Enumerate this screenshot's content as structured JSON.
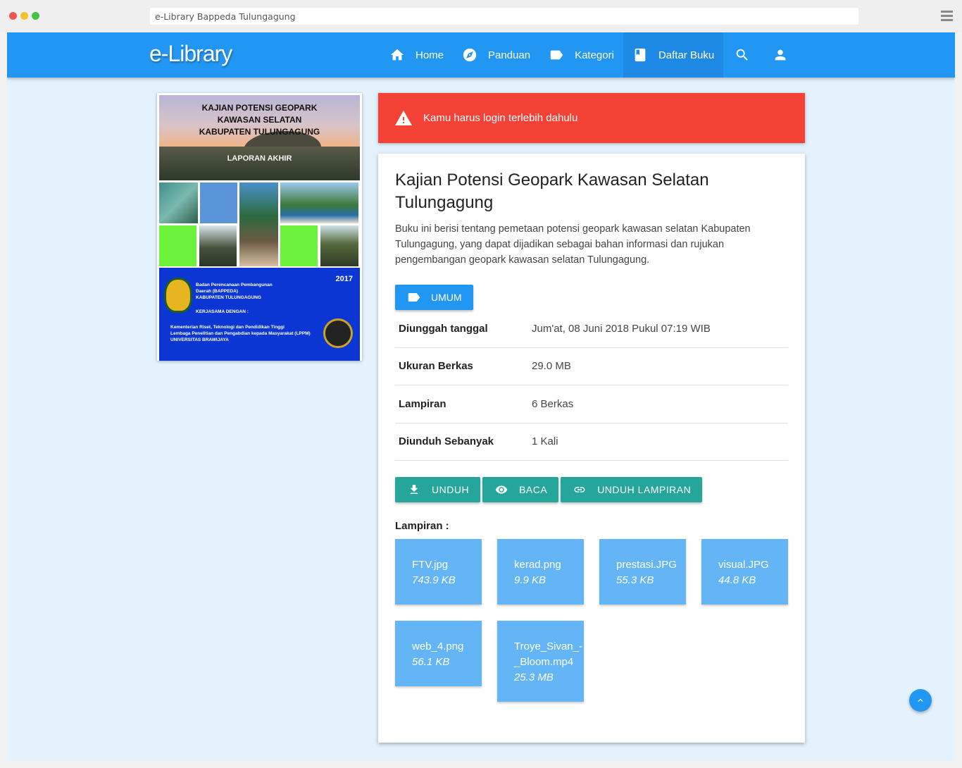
{
  "browser": {
    "url": "e-Library Bappeda Tulungagung"
  },
  "navbar": {
    "brand": "e-Library",
    "items": [
      {
        "label": "Home",
        "icon": "home-icon"
      },
      {
        "label": "Panduan",
        "icon": "compass-icon"
      },
      {
        "label": "Kategori",
        "icon": "label-icon"
      },
      {
        "label": "Daftar Buku",
        "icon": "book-icon",
        "active": true
      }
    ],
    "search_icon": "search-icon",
    "user_icon": "user-icon"
  },
  "cover": {
    "title_lines": [
      "KAJIAN POTENSI GEOPARK",
      "KAWASAN SELATAN",
      "KABUPATEN TULUNGAGUNG"
    ],
    "subtitle": "LAPORAN AKHIR",
    "year": "2017",
    "agency_lines": [
      "Badan Perencanaan Pembangunan",
      "Daerah (BAPPEDA)",
      "KABUPATEN TULUNGAGUNG"
    ],
    "cooperation": "KERJASAMA DENGAN :",
    "partner_lines": [
      "Kementerian Riset, Teknologi dan Pendidikan Tinggi",
      "Lembaga Penelitian dan Pengabdian kepada Masyarakat (LPPM)",
      "UNIVERSITAS BRAWIJAYA"
    ]
  },
  "alert": {
    "message": "Kamu harus login terlebih dahulu",
    "icon": "warning-icon"
  },
  "book": {
    "title": "Kajian Potensi Geopark Kawasan Selatan Tulungagung",
    "description": "Buku ini berisi tentang pemetaan potensi geopark kawasan selatan Kabupaten Tulungagung, yang dapat dijadikan sebagai bahan informasi dan rujukan pengembangan geopark kawasan selatan Tulungagung.",
    "category": "UMUM",
    "info": [
      {
        "label": "Diunggah tanggal",
        "value": "Jum'at, 08 Juni 2018 Pukul 07:19 WIB"
      },
      {
        "label": "Ukuran Berkas",
        "value": "29.0 MB"
      },
      {
        "label": "Lampiran",
        "value": "6 Berkas"
      },
      {
        "label": "Diunduh Sebanyak",
        "value": "1 Kali"
      }
    ],
    "actions": [
      {
        "label": "UNDUH",
        "icon": "download-icon"
      },
      {
        "label": "BACA",
        "icon": "eye-icon"
      },
      {
        "label": "UNDUH LAMPIRAN",
        "icon": "link-icon"
      }
    ],
    "attachments_heading": "Lampiran :",
    "attachments": [
      {
        "name": "FTV.jpg",
        "size": "743.9 KB"
      },
      {
        "name": "kerad.png",
        "size": "9.9 KB"
      },
      {
        "name": "prestasi.JPG",
        "size": "55.3 KB"
      },
      {
        "name": "visual.JPG",
        "size": "44.8 KB"
      },
      {
        "name": "web_4.png",
        "size": "56.1 KB"
      },
      {
        "name": "Troye_Sivan_-_Bloom.mp4",
        "name_lines": [
          "Troye_Sivan_-",
          "_Bloom.mp4"
        ],
        "size": "25.3 MB"
      }
    ]
  },
  "colors": {
    "primary": "#2196f3",
    "danger": "#f44336",
    "teal": "#26a69a",
    "attachment": "#64b5f6",
    "background": "#e3f2fd"
  }
}
